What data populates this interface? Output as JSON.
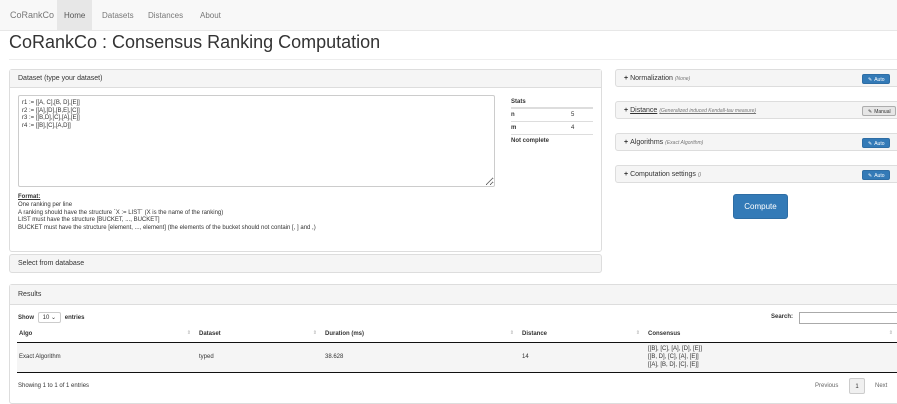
{
  "nav": {
    "brand": "CoRankCo",
    "items": [
      {
        "label": "Home",
        "active": true
      },
      {
        "label": "Datasets",
        "active": false
      },
      {
        "label": "Distances",
        "active": false
      },
      {
        "label": "About",
        "active": false
      }
    ]
  },
  "page_title": "CoRankCo : Consensus Ranking Computation",
  "dataset_panel": {
    "heading": "Dataset (type your dataset)",
    "text": "r1 := [[A, C],[B, D],[E]]\nr2 := [[A],[D],[B,E],[C]]\nr3 := [[B,D],[C],[A],[E]]\nr4 := [[B],[C],[A,D]]",
    "stats": {
      "title": "Stats",
      "rows": [
        {
          "label": "n",
          "value": "5"
        },
        {
          "label": "m",
          "value": "4"
        }
      ],
      "status": "Not complete"
    },
    "format": {
      "title": "Format:",
      "lines": [
        "One ranking per line",
        "A ranking should have the structure `X := LIST` (X is the name of the ranking)",
        "LIST must have the structure [BUCKET, ..., BUCKET]",
        "BUCKET must have the structure [element, ..., element] (the elements of the bucket should not contain [, ] and ,)"
      ]
    }
  },
  "select_db_heading": "Select from database",
  "right_panels": {
    "normalization": {
      "label": "Normalization",
      "sub": "(None)",
      "button": "Auto"
    },
    "distance": {
      "label": "Distance",
      "sub": "(Generalized induced Kendall-tau measure)",
      "button": "Manual"
    },
    "algorithms": {
      "label": "Algorithms",
      "sub": "(Exact Algorithm)",
      "button": "Auto"
    },
    "settings": {
      "label": "Computation settings",
      "sub": "()",
      "button": "Auto"
    }
  },
  "compute_label": "Compute",
  "results": {
    "heading": "Results",
    "show_label": "Show",
    "entries_value": "10",
    "entries_label": "entries",
    "search_label": "Search:",
    "columns": [
      "Algo",
      "Dataset",
      "Duration (ms)",
      "Distance",
      "Consensus"
    ],
    "row": {
      "algo": "Exact Algorithm",
      "dataset": "typed",
      "duration": "38.628",
      "distance": "14",
      "consensus": [
        "[[B], [C], [A], [D], [E]]",
        "[[B, D], [C], [A], [E]]",
        "[[A], [B, D], [C], [E]]"
      ]
    },
    "info": "Showing 1 to 1 of 1 entries",
    "pager": {
      "previous": "Previous",
      "current": "1",
      "next": "Next"
    }
  }
}
